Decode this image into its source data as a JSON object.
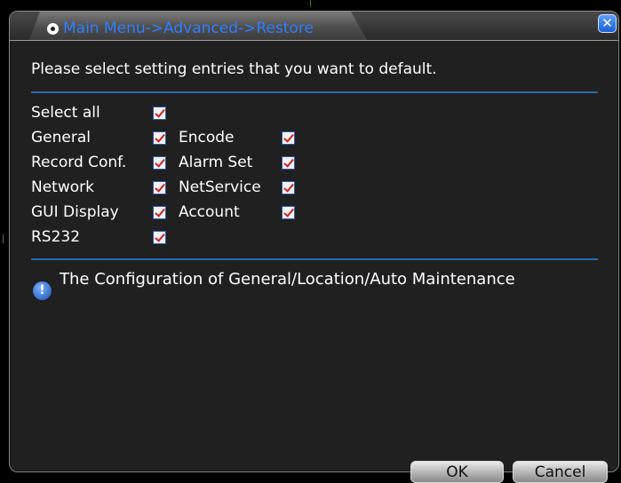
{
  "window": {
    "title": "Main Menu->Advanced->Restore",
    "close_label": "✕"
  },
  "instruction": "Please select setting entries that you want to default.",
  "options": {
    "select_all": {
      "label": "Select all",
      "checked": true
    },
    "general": {
      "label": "General",
      "checked": true
    },
    "encode": {
      "label": "Encode",
      "checked": true
    },
    "record_conf": {
      "label": "Record Conf.",
      "checked": true
    },
    "alarm_set": {
      "label": "Alarm Set",
      "checked": true
    },
    "network": {
      "label": "Network",
      "checked": true
    },
    "netservice": {
      "label": "NetService",
      "checked": true
    },
    "gui_display": {
      "label": "GUI Display",
      "checked": true
    },
    "account": {
      "label": "Account",
      "checked": true
    },
    "rs232": {
      "label": "RS232",
      "checked": true
    }
  },
  "info": {
    "icon": "!",
    "text": "The Configuration of General/Location/Auto Maintenance"
  },
  "buttons": {
    "ok": "OK",
    "cancel": "Cancel"
  },
  "colors": {
    "title_text": "#2f7fff",
    "divider": "#2a6ab0",
    "check_mark": "#d02020"
  }
}
